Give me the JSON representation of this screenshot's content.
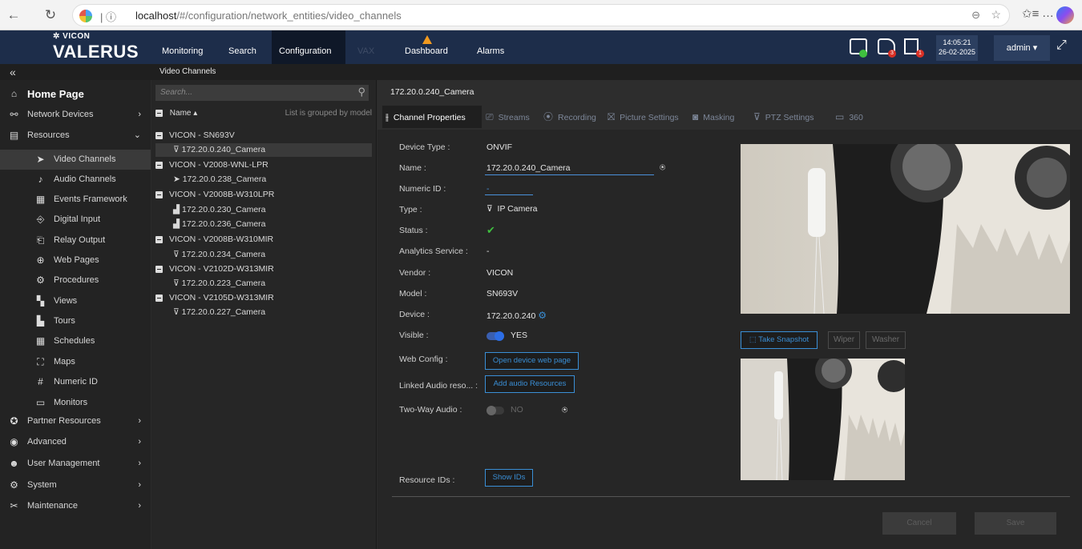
{
  "browser": {
    "url_host": "localhost",
    "url_path": "/#/configuration/network_entities/video_channels"
  },
  "app": {
    "logo_small": "VICON",
    "logo": "VALERUS"
  },
  "topnav": {
    "tabs": [
      "Monitoring",
      "Search",
      "Configuration",
      "VAX"
    ],
    "dashboard": "Dashboard",
    "alarms": "Alarms",
    "badge_a": "3",
    "badge_b": "1",
    "time": "14:05:21",
    "date": "26-02-2025",
    "user": "admin ▾"
  },
  "subbar": {
    "title": "Video Channels"
  },
  "sidebar": {
    "home": "Home Page",
    "items": [
      {
        "label": "Network Devices"
      },
      {
        "label": "Resources"
      },
      {
        "label": "Video Channels"
      },
      {
        "label": "Audio Channels"
      },
      {
        "label": "Events Framework"
      },
      {
        "label": "Digital Input"
      },
      {
        "label": "Relay Output"
      },
      {
        "label": "Web Pages"
      },
      {
        "label": "Procedures"
      },
      {
        "label": "Views"
      },
      {
        "label": "Tours"
      },
      {
        "label": "Schedules"
      },
      {
        "label": "Maps"
      },
      {
        "label": "Numeric ID"
      },
      {
        "label": "Monitors"
      },
      {
        "label": "Partner Resources"
      },
      {
        "label": "Advanced"
      },
      {
        "label": "User Management"
      },
      {
        "label": "System"
      },
      {
        "label": "Maintenance"
      }
    ]
  },
  "list": {
    "search_placeholder": "Search...",
    "name_header": "Name",
    "grouped_note": "List is grouped by model",
    "rows": [
      {
        "text": "VICON - SN693V"
      },
      {
        "text": "172.20.0.240_Camera"
      },
      {
        "text": "VICON - V2008-WNL-LPR"
      },
      {
        "text": "172.20.0.238_Camera"
      },
      {
        "text": "VICON - V2008B-W310LPR"
      },
      {
        "text": "172.20.0.230_Camera"
      },
      {
        "text": "172.20.0.236_Camera"
      },
      {
        "text": "VICON - V2008B-W310MIR"
      },
      {
        "text": "172.20.0.234_Camera"
      },
      {
        "text": "VICON - V2102D-W313MIR"
      },
      {
        "text": "172.20.0.223_Camera"
      },
      {
        "text": "VICON - V2105D-W313MIR"
      },
      {
        "text": "172.20.0.227_Camera"
      }
    ]
  },
  "content": {
    "title": "172.20.0.240_Camera",
    "tabs": [
      "Channel Properties",
      "Streams",
      "Recording",
      "Picture Settings",
      "Masking",
      "PTZ Settings",
      "360"
    ],
    "labels": {
      "device_type": "Device Type :",
      "name": "Name :",
      "numeric_id": "Numeric ID :",
      "type": "Type :",
      "status": "Status :",
      "analytics": "Analytics Service :",
      "vendor": "Vendor :",
      "model": "Model :",
      "device": "Device :",
      "visible": "Visible :",
      "web_config": "Web Config :",
      "linked_audio": "Linked Audio reso... :",
      "two_way": "Two-Way Audio :",
      "resource_ids": "Resource IDs :"
    },
    "values": {
      "device_type": "ONVIF",
      "name": "172.20.0.240_Camera",
      "numeric_id": "-",
      "type": "IP Camera",
      "analytics": "-",
      "vendor": "VICON",
      "model": "SN693V",
      "device": "172.20.0.240",
      "visible": "YES",
      "two_way": "NO"
    },
    "buttons": {
      "open_web": "Open device web page",
      "add_audio": "Add audio Resources",
      "show_ids": "Show IDs",
      "snapshot": "Take Snapshot",
      "wiper": "Wiper",
      "washer": "Washer",
      "cancel": "Cancel",
      "save": "Save"
    }
  },
  "colors": {
    "accent": "#3a8fd6",
    "topbar": "#1d2d4a",
    "success": "#3fbf3f"
  }
}
